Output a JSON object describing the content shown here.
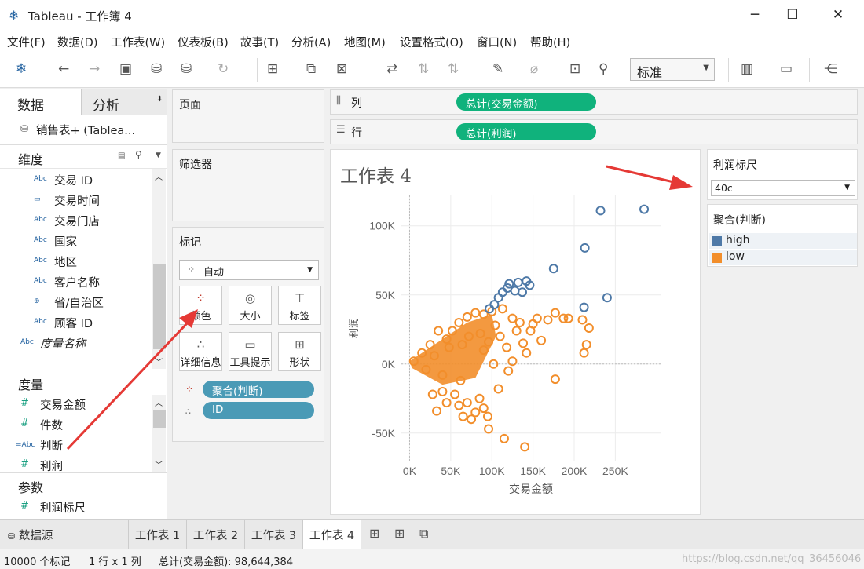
{
  "window": {
    "title": "Tableau - 工作簿 4",
    "min": "─",
    "max": "☐",
    "close": "✕"
  },
  "menu": [
    "文件(F)",
    "数据(D)",
    "工作表(W)",
    "仪表板(B)",
    "故事(T)",
    "分析(A)",
    "地图(M)",
    "设置格式(O)",
    "窗口(N)",
    "帮助(H)"
  ],
  "toolbar": {
    "fit_value": "标准"
  },
  "left_pane": {
    "tab_data": "数据",
    "tab_analysis": "分析",
    "datasource": "销售表+ (Tablea...",
    "dimensions_title": "维度",
    "dimensions": [
      {
        "icon": "Abc",
        "label": "交易 ID"
      },
      {
        "icon": "▭",
        "label": "交易时间"
      },
      {
        "icon": "Abc",
        "label": "交易门店"
      },
      {
        "icon": "Abc",
        "label": "国家"
      },
      {
        "icon": "Abc",
        "label": "地区"
      },
      {
        "icon": "Abc",
        "label": "客户名称"
      },
      {
        "icon": "⊕",
        "label": "省/自治区"
      },
      {
        "icon": "Abc",
        "label": "顾客 ID"
      }
    ],
    "measure_names": "度量名称",
    "measures_title": "度量",
    "measures": [
      {
        "icon": "#",
        "label": "交易金额"
      },
      {
        "icon": "#",
        "label": "件数"
      },
      {
        "icon": "=Abc",
        "label": "判断"
      },
      {
        "icon": "#",
        "label": "利润"
      }
    ],
    "params_title": "参数",
    "params": [
      {
        "icon": "#",
        "label": "利润标尺"
      }
    ]
  },
  "shelves": {
    "pages": "页面",
    "filters": "筛选器",
    "columns_label": "列",
    "columns_pill": "总计(交易金额)",
    "rows_label": "行",
    "rows_pill": "总计(利润)"
  },
  "marks": {
    "title": "标记",
    "type": "自动",
    "buttons": [
      {
        "name": "color",
        "label": "颜色"
      },
      {
        "name": "size",
        "label": "大小"
      },
      {
        "name": "label",
        "label": "标签"
      },
      {
        "name": "detail",
        "label": "详细信息"
      },
      {
        "name": "tooltip",
        "label": "工具提示"
      },
      {
        "name": "shape",
        "label": "形状"
      }
    ],
    "pills": [
      "聚合(判断)",
      "ID"
    ]
  },
  "worksheet_title": "工作表 4",
  "legend": {
    "param_title": "利润标尺",
    "param_value": "40c",
    "color_title": "聚合(判断)",
    "items": [
      {
        "label": "high",
        "color": "#4e79a7"
      },
      {
        "label": "low",
        "color": "#f28e2b"
      }
    ]
  },
  "chart_data": {
    "type": "scatter",
    "xlabel": "交易金额",
    "ylabel": "利润",
    "xticks": [
      "0K",
      "50K",
      "100K",
      "150K",
      "200K",
      "250K"
    ],
    "yticks": [
      "-50K",
      "0K",
      "50K",
      "100K"
    ],
    "xlim": [
      -10000,
      305000
    ],
    "ylim": [
      -70000,
      122000
    ],
    "series": [
      {
        "name": "high",
        "color": "#4e79a7",
        "points": [
          [
            232000,
            111000
          ],
          [
            285000,
            112000
          ],
          [
            213000,
            84000
          ],
          [
            175000,
            69000
          ],
          [
            240000,
            48000
          ],
          [
            212000,
            41000
          ],
          [
            142000,
            60000
          ],
          [
            121000,
            58000
          ],
          [
            132000,
            59000
          ],
          [
            146000,
            57000
          ],
          [
            108000,
            48000
          ],
          [
            113000,
            52000
          ],
          [
            119000,
            55000
          ],
          [
            103000,
            43000
          ],
          [
            97000,
            40000
          ],
          [
            128000,
            53000
          ],
          [
            137000,
            52000
          ]
        ]
      },
      {
        "name": "low",
        "color": "#f28e2b",
        "points": [
          [
            60000,
            30000
          ],
          [
            70000,
            34000
          ],
          [
            80000,
            37000
          ],
          [
            90000,
            36000
          ],
          [
            100000,
            38000
          ],
          [
            113000,
            40000
          ],
          [
            125000,
            33000
          ],
          [
            134000,
            30000
          ],
          [
            150000,
            29000
          ],
          [
            155000,
            33000
          ],
          [
            168000,
            32000
          ],
          [
            177000,
            37000
          ],
          [
            187000,
            33000
          ],
          [
            193000,
            33000
          ],
          [
            210000,
            32000
          ],
          [
            218000,
            26000
          ],
          [
            215000,
            14000
          ],
          [
            212000,
            8000
          ],
          [
            177000,
            -11000
          ],
          [
            140000,
            -60000
          ],
          [
            115000,
            -54000
          ],
          [
            96000,
            -47000
          ],
          [
            90000,
            -32000
          ],
          [
            75000,
            -40000
          ],
          [
            65000,
            -38000
          ],
          [
            80000,
            -35000
          ],
          [
            70000,
            -28000
          ],
          [
            55000,
            -22000
          ],
          [
            33000,
            -34000
          ],
          [
            45000,
            -28000
          ],
          [
            40000,
            -20000
          ],
          [
            60000,
            -30000
          ],
          [
            85000,
            -25000
          ],
          [
            95000,
            -38000
          ],
          [
            120000,
            -5000
          ],
          [
            142000,
            8000
          ],
          [
            138000,
            15000
          ],
          [
            110000,
            20000
          ],
          [
            125000,
            2000
          ],
          [
            102000,
            0
          ],
          [
            90000,
            10000
          ],
          [
            30000,
            6000
          ],
          [
            40000,
            -8000
          ],
          [
            20000,
            -4000
          ],
          [
            48000,
            12000
          ],
          [
            64000,
            14000
          ],
          [
            72000,
            20000
          ],
          [
            52000,
            24000
          ],
          [
            45000,
            18000
          ],
          [
            86000,
            22000
          ],
          [
            96000,
            16000
          ],
          [
            104000,
            28000
          ],
          [
            118000,
            12000
          ],
          [
            130000,
            24000
          ],
          [
            147000,
            24000
          ],
          [
            160000,
            17000
          ],
          [
            108000,
            -18000
          ],
          [
            62000,
            -12000
          ],
          [
            35000,
            24000
          ],
          [
            28000,
            -22000
          ],
          [
            5000,
            2000
          ],
          [
            15000,
            8000
          ],
          [
            25000,
            14000
          ]
        ]
      }
    ]
  }
}
